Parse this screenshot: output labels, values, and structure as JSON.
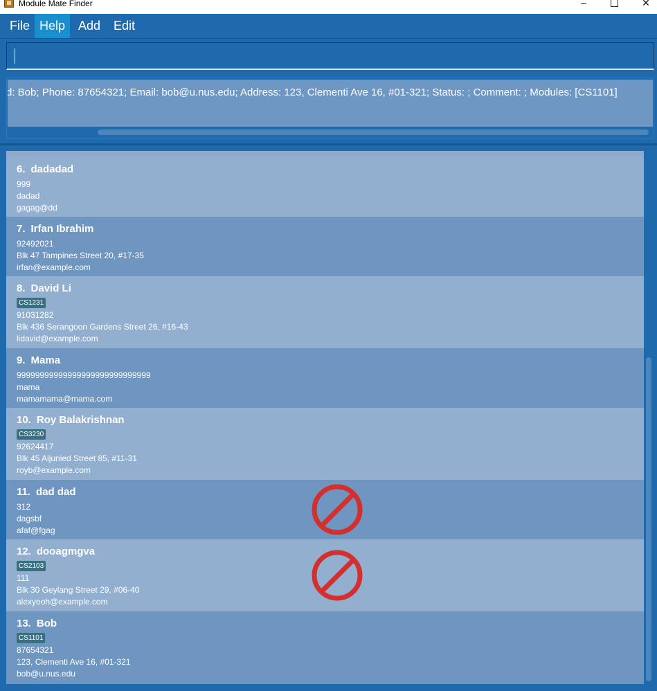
{
  "window": {
    "title": "Module Mate Finder"
  },
  "menu": {
    "items": [
      "File",
      "Help",
      "Add",
      "Edit"
    ],
    "active": "Help"
  },
  "command": {
    "value": ""
  },
  "result": {
    "text": "d: Bob; Phone: 87654321; Email: bob@u.nus.edu; Address: 123, Clementi Ave 16, #01-321; Status: ; Comment: ; Modules: [CS1101]"
  },
  "persons": [
    {
      "index": "6.",
      "name": "dadadad",
      "tag": "",
      "phone": "999",
      "address": "dadad",
      "email": "gagag@dd"
    },
    {
      "index": "7.",
      "name": "Irfan Ibrahim",
      "tag": "",
      "phone": "92492021",
      "address": "Blk 47 Tampines Street 20, #17-35",
      "email": "irfan@example.com"
    },
    {
      "index": "8.",
      "name": "David Li",
      "tag": "CS1231",
      "phone": "91031282",
      "address": "Blk 436 Serangoon Gardens Street 26, #16-43",
      "email": "lidavid@example.com"
    },
    {
      "index": "9.",
      "name": "Mama",
      "tag": "",
      "phone": "99999999999999999999999999999",
      "address": "mama",
      "email": "mamamama@mama.com"
    },
    {
      "index": "10.",
      "name": "Roy Balakrishnan",
      "tag": "CS3230",
      "phone": "92624417",
      "address": "Blk 45 Aljunied Street 85, #11-31",
      "email": "royb@example.com"
    },
    {
      "index": "11.",
      "name": "dad dad",
      "tag": "",
      "phone": "312",
      "address": "dagsbf",
      "email": "afaf@fgag"
    },
    {
      "index": "12.",
      "name": "dooagmgva",
      "tag": "CS2103",
      "phone": "111",
      "address": "Blk 30 Geylang Street 29, #06-40",
      "email": "alexyeoh@example.com"
    },
    {
      "index": "13.",
      "name": "Bob",
      "tag": "CS1101",
      "phone": "87654321",
      "address": "123, Clementi Ave 16, #01-321",
      "email": "bob@u.nus.edu"
    }
  ],
  "icons": {
    "cursor": "not-allowed-icon",
    "accent": "#d32f2f"
  }
}
